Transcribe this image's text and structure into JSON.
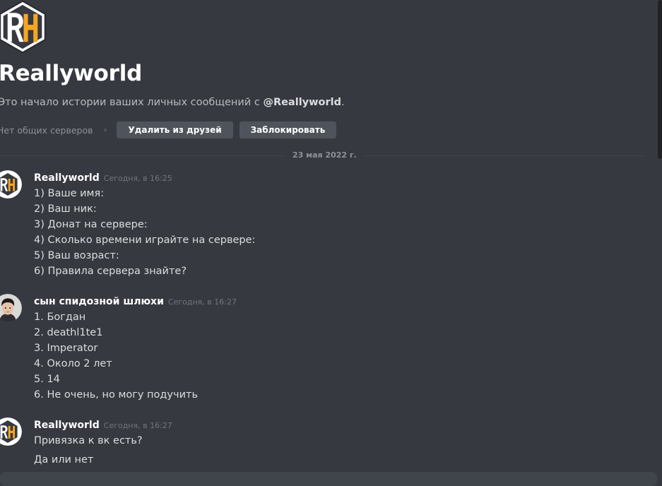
{
  "header": {
    "title": "Reallyworld",
    "desc_prefix": "Это начало истории ваших личных сообщений с ",
    "desc_user": "@Reallyworld",
    "desc_suffix": ".",
    "mutual_servers": "Нет общих серверов",
    "remove_friend_label": "Удалить из друзей",
    "block_label": "Заблокировать"
  },
  "divider_date": "23 мая 2022 г.",
  "messages": [
    {
      "author": "Reallyworld",
      "timestamp": "Сегодня, в 16:25",
      "lines": [
        "1) Ваше имя:",
        "2) Ваш ник:",
        "3) Донат на сервере:",
        "4) Сколько времени играйте на сервере:",
        "5) Ваш возраст:",
        "6) Правила сервера знайте?"
      ]
    },
    {
      "author": "сын  спидозной шлюхи",
      "timestamp": "Сегодня, в 16:27",
      "lines": [
        "1. Богдан",
        "2. deathl1te1",
        "3. Imperator",
        "4. Около 2 лет",
        "5. 14",
        "6. Не очень, но могу подучить"
      ]
    },
    {
      "author": "Reallyworld",
      "timestamp": "Сегодня, в 16:27",
      "lines": [
        "Привязка к вк есть?",
        "Да или нет"
      ]
    }
  ],
  "colors": {
    "background": "#36393f",
    "logo_orange": "#f5a623",
    "logo_bg": "#ffffff"
  },
  "icons": {
    "logo": "reallyworld-logo-icon",
    "avatar_user": "user-avatar-photo"
  }
}
